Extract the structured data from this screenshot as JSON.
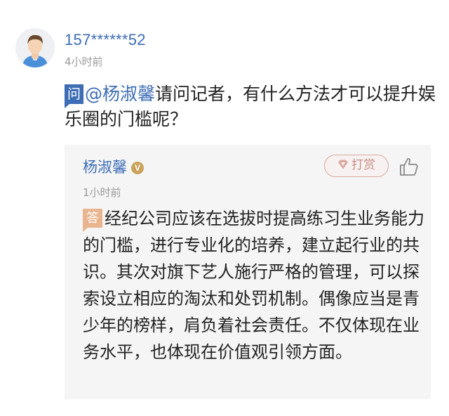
{
  "post": {
    "username": "157******52",
    "time": "4小时前",
    "question_badge": "问",
    "mention": "@杨淑馨",
    "question_text": "请问记者，有什么方法才可以提升娱乐圈的门槛呢？"
  },
  "answer": {
    "author": "杨淑馨",
    "verified_badge": "V",
    "tip_label": "打赏",
    "time": "1小时前",
    "answer_badge": "答",
    "text": "经纪公司应该在选拔时提高练习生业务能力的门槛，进行专业化的培养，建立起行业的共识。其次对旗下艺人施行严格的管理，可以探索设立相应的淘汰和处罚机制。偶像应当是青少年的榜样，肩负着社会责任。不仅体现在业务水平，也体现在价值观引领方面。"
  },
  "icons": {
    "avatar": "user-avatar-icon",
    "tip": "gem-icon",
    "like": "thumbs-up-icon",
    "verified": "verified-badge-icon"
  },
  "colors": {
    "accent_blue": "#3d6db5",
    "answer_badge": "#e9b58f",
    "tip_border": "#d8a8a0",
    "verified": "#caa25a",
    "muted_text": "#9a9a9a",
    "answer_bg": "#f5f5f5"
  }
}
